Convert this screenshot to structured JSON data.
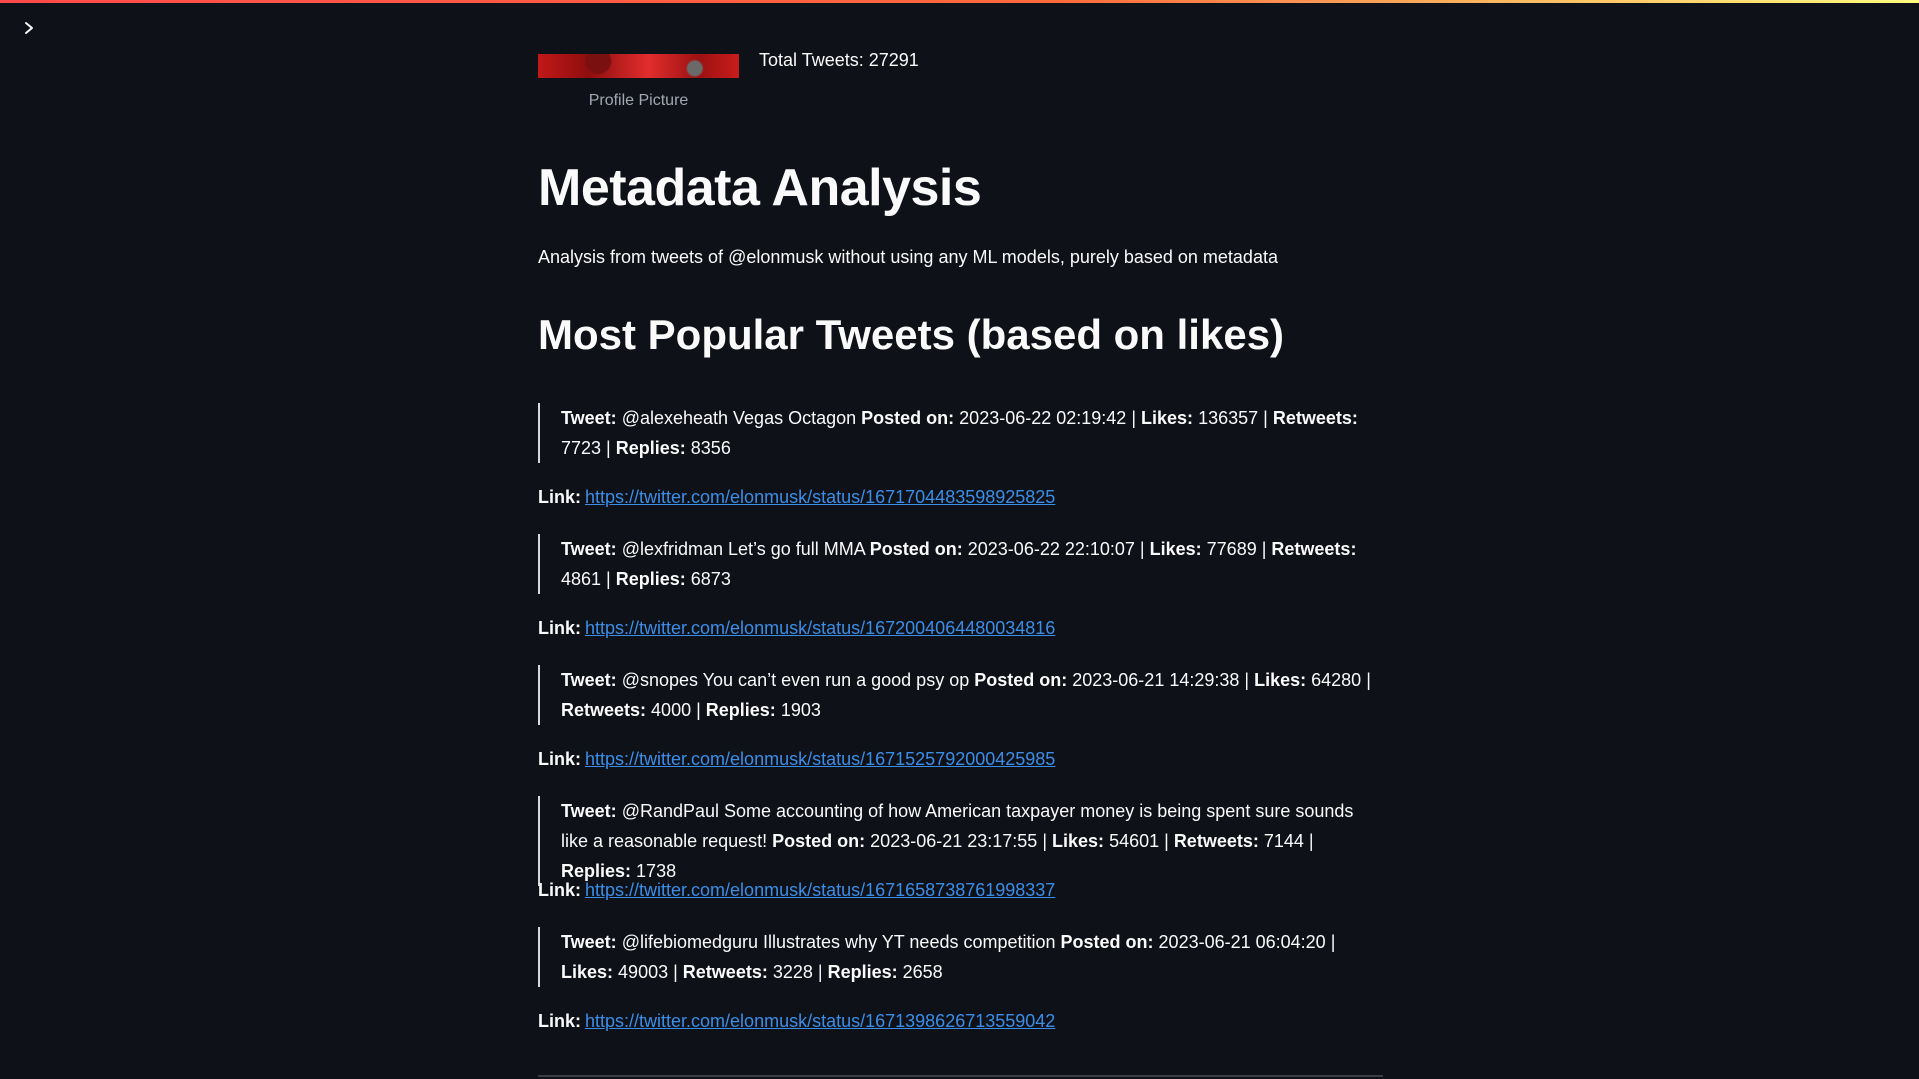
{
  "header": {
    "total_tweets_label": "Total Tweets: 27291",
    "profile_caption": "Profile Picture"
  },
  "main": {
    "title": "Metadata Analysis",
    "description": "Analysis from tweets of @elonmusk without using any ML models, purely based on metadata",
    "section_title": "Most Popular Tweets (based on likes)"
  },
  "labels": {
    "tweet": "Tweet:",
    "posted_on": "Posted on:",
    "likes": "Likes:",
    "retweets": "Retweets:",
    "replies": "Replies:",
    "link": "Link:"
  },
  "tweets": [
    {
      "text": "@alexeheath Vegas Octagon",
      "posted_on": "2023-06-22 02:19:42",
      "likes": "136357",
      "retweets": "7723",
      "replies": "8356",
      "link": "https://twitter.com/elonmusk/status/1671704483598925825"
    },
    {
      "text": "@lexfridman Let’s go full MMA",
      "posted_on": "2023-06-22 22:10:07",
      "likes": "77689",
      "retweets": "4861",
      "replies": "6873",
      "link": "https://twitter.com/elonmusk/status/1672004064480034816"
    },
    {
      "text": "@snopes You can’t even run a good psy op",
      "posted_on": "2023-06-21 14:29:38",
      "likes": "64280",
      "retweets": "4000",
      "replies": "1903",
      "link": "https://twitter.com/elonmusk/status/1671525792000425985"
    },
    {
      "text": "@RandPaul Some accounting of how American taxpayer money is being spent sure sounds like a reasonable request!",
      "posted_on": "2023-06-21 23:17:55",
      "likes": "54601",
      "retweets": "7144",
      "replies": "1738",
      "link": "https://twitter.com/elonmusk/status/1671658738761998337"
    },
    {
      "text": "@lifebiomedguru Illustrates why YT needs competition",
      "posted_on": "2023-06-21 06:04:20",
      "likes": "49003",
      "retweets": "3228",
      "replies": "2658",
      "link": "https://twitter.com/elonmusk/status/1671398626713559042"
    }
  ],
  "colors": {
    "background": "#0e1117",
    "text": "#fafafa",
    "link": "#3b8ee8"
  },
  "icons": {
    "sidebar_toggle": "chevron-right-icon"
  }
}
